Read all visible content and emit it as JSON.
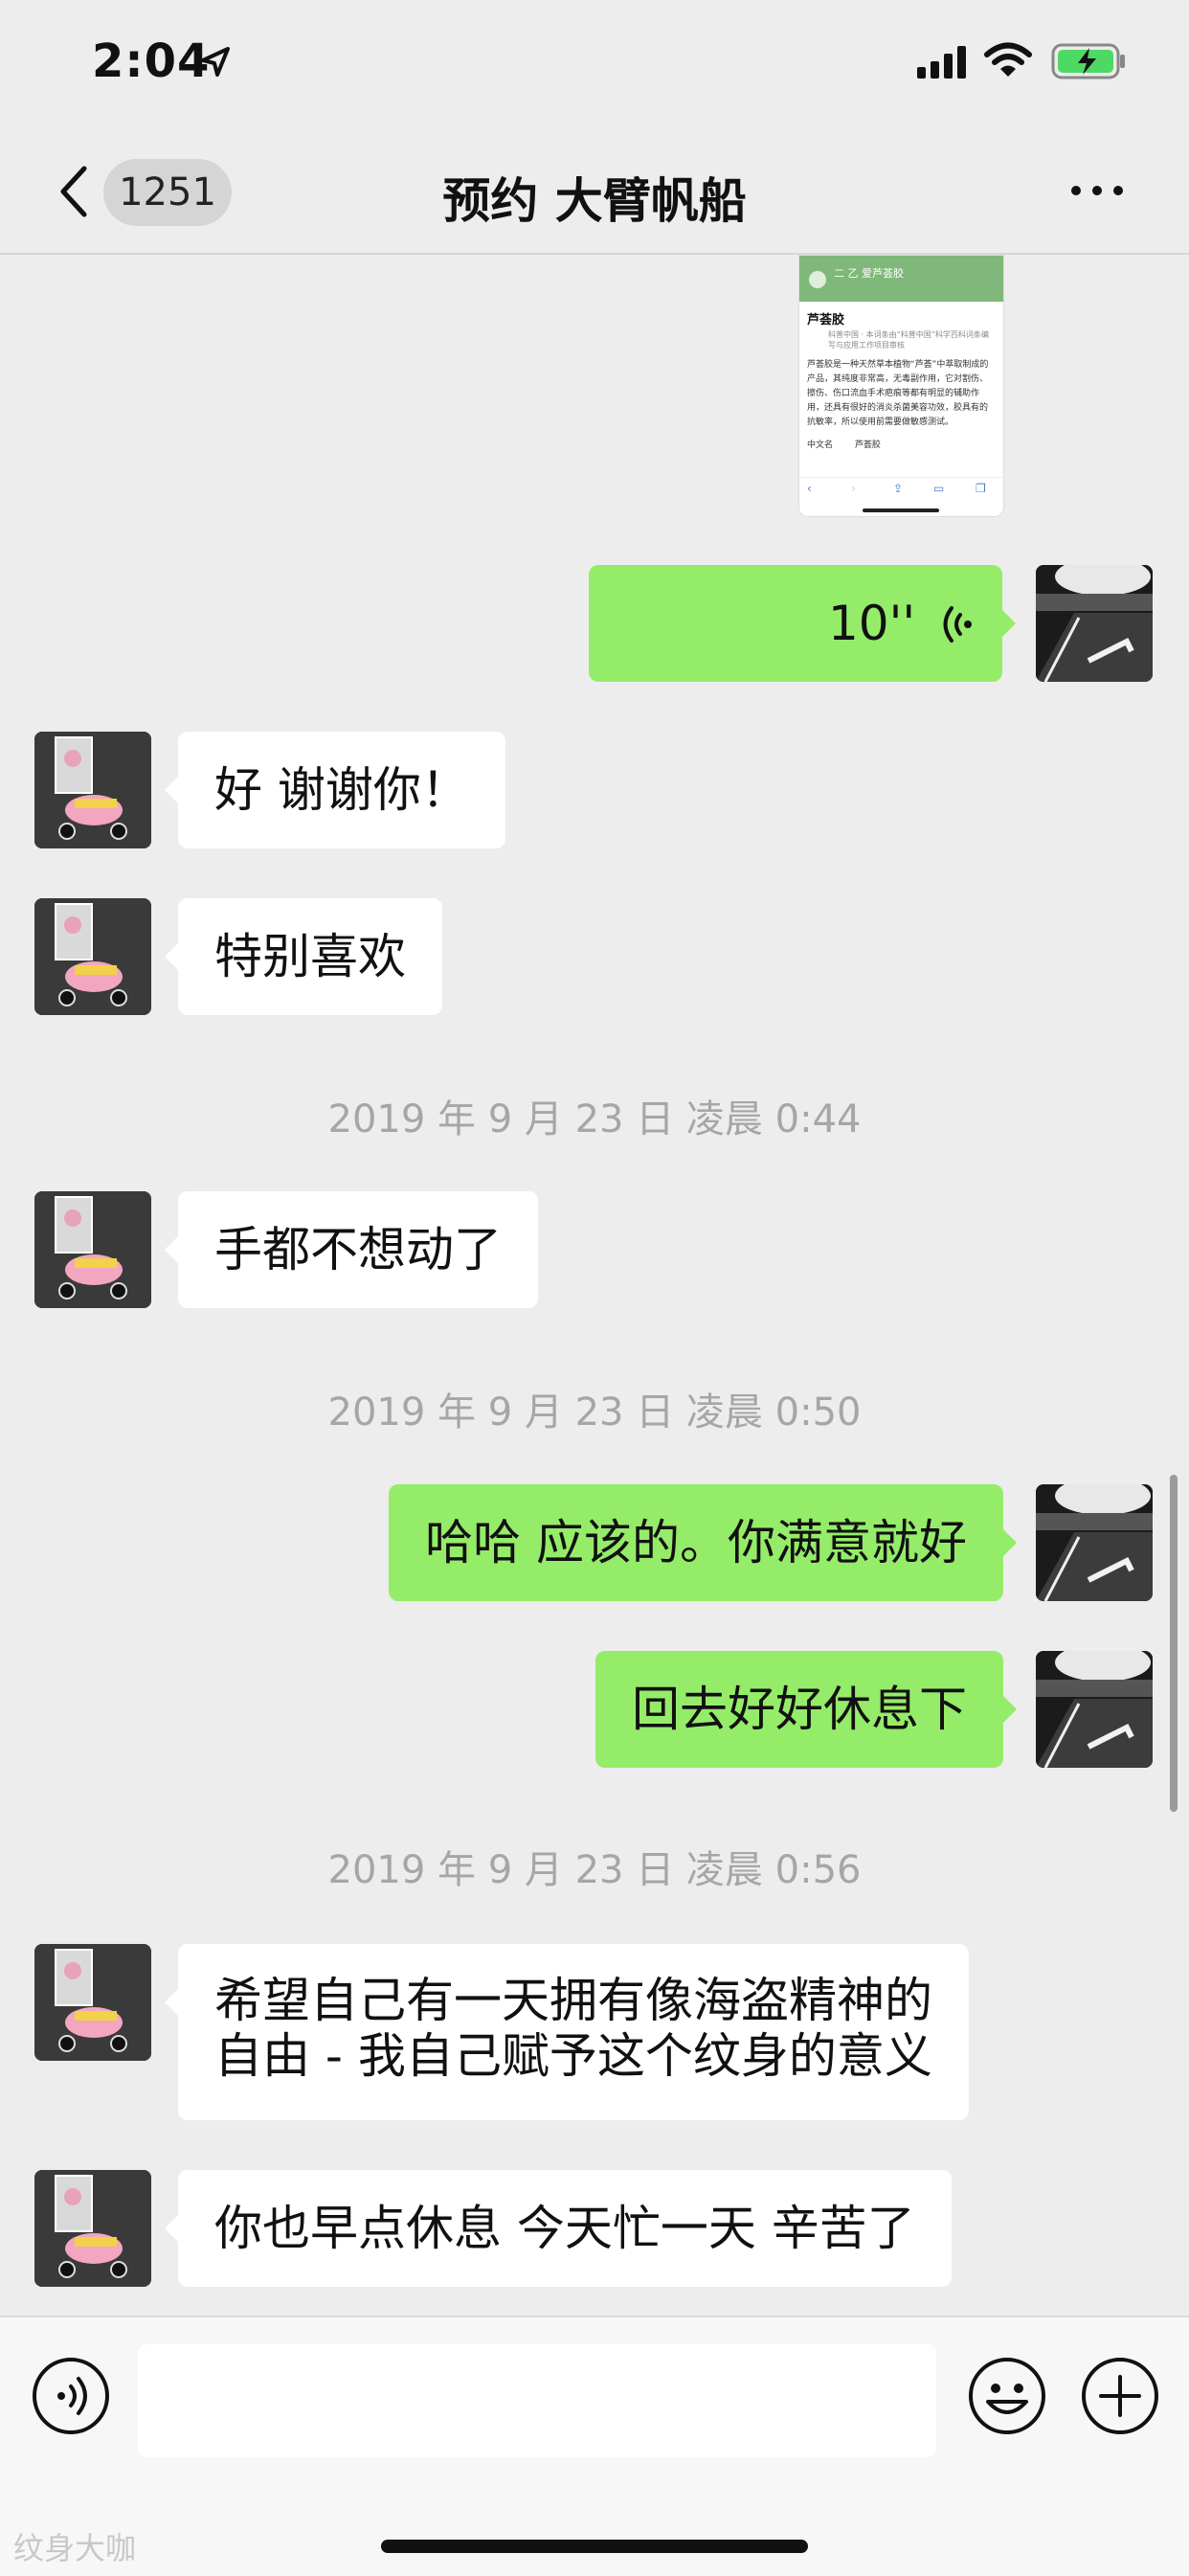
{
  "status_bar": {
    "time": "2:04",
    "icons": [
      "location-arrow-icon",
      "cellular-signal-icon",
      "wifi-icon",
      "battery-charging-icon"
    ]
  },
  "nav": {
    "back_icon": "chevron-left-icon",
    "unread_count": "1251",
    "title": "预约 大臂帆船",
    "more_icon": "more-dots-icon"
  },
  "shared_image": {
    "header_text": "二 乙 爱芦荟胶",
    "title": "芦荟胶",
    "meta": "科普中国 · 本词条由“科普中国”科学百科词条编写与应用工作项目审核",
    "body": "芦荟胶是一种天然草本植物“芦荟”中萃取制成的产品，其纯度非常高，无毒副作用，它对割伤、擦伤、伤口流血手术疤痕等都有明显的辅助作用，还具有很好的消炎杀菌美容功效，胶具有的抗敏率，所以使用前需要做敏感测试。",
    "row_label": "中文名",
    "row_value": "芦荟胶"
  },
  "messages": [
    {
      "side": "right",
      "type": "voice",
      "duration": "10''"
    },
    {
      "side": "left",
      "text": "好 谢谢你！"
    },
    {
      "side": "left",
      "text": "特别喜欢"
    },
    {
      "timestamp": "2019 年 9 月 23 日  凌晨 0:44"
    },
    {
      "side": "left",
      "text": "手都不想动了"
    },
    {
      "timestamp": "2019 年 9 月 23 日  凌晨 0:50"
    },
    {
      "side": "right",
      "text": "哈哈 应该的。你满意就好"
    },
    {
      "side": "right",
      "text": "回去好好休息下"
    },
    {
      "timestamp": "2019 年 9 月 23 日  凌晨 0:56"
    },
    {
      "side": "left",
      "text_line1": "希望自己有一天拥有像海盗精神的",
      "text_line2": "自由 - 我自己赋予这个纹身的意义"
    },
    {
      "side": "left",
      "text": "你也早点休息 今天忙一天 辛苦了"
    }
  ],
  "input_bar": {
    "voice_icon": "voice-input-icon",
    "emoji_icon": "emoji-icon",
    "plus_icon": "plus-circle-icon",
    "placeholder": ""
  },
  "watermark": "纹身大咖",
  "colors": {
    "background": "#ededed",
    "self_bubble": "#95ec69",
    "other_bubble": "#ffffff",
    "timestamp": "#a6a6a6"
  }
}
